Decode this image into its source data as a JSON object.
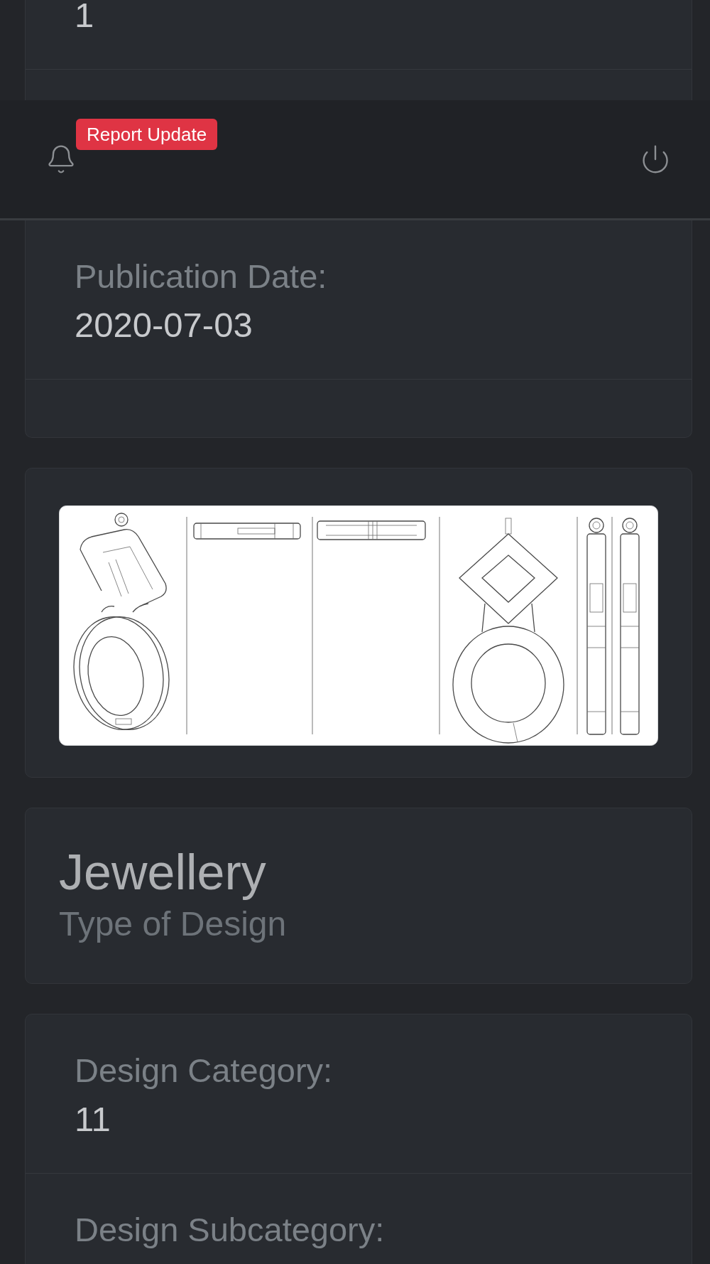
{
  "top_card": {
    "fields": [
      {
        "value": "1"
      }
    ]
  },
  "header": {
    "badge": "Report Update"
  },
  "cards": [
    {
      "kind": "fields",
      "fields": [
        {
          "label": "Publication Date:",
          "value": "2020-07-03"
        }
      ]
    },
    {
      "kind": "image"
    },
    {
      "kind": "title",
      "title": "Jewellery",
      "subtitle": "Type of Design"
    },
    {
      "kind": "fields",
      "fields": [
        {
          "label": "Design Category:",
          "value": "11"
        },
        {
          "label": "Design Subcategory:"
        }
      ]
    }
  ]
}
